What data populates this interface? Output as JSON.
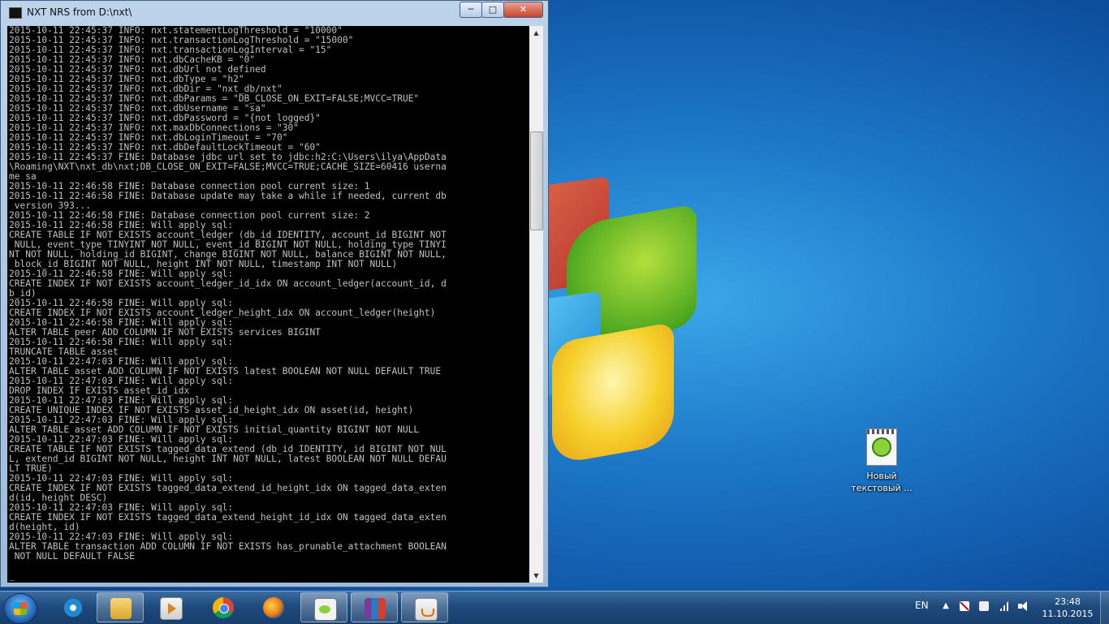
{
  "window": {
    "title": "NXT NRS from D:\\nxt\\",
    "controls": {
      "minimize": "─",
      "maximize": "□",
      "close": "✕"
    }
  },
  "console_lines": [
    "2015-10-11 22:45:37 INFO: nxt.statementLogThreshold = \"10000\"",
    "2015-10-11 22:45:37 INFO: nxt.transactionLogThreshold = \"15000\"",
    "2015-10-11 22:45:37 INFO: nxt.transactionLogInterval = \"15\"",
    "2015-10-11 22:45:37 INFO: nxt.dbCacheKB = \"0\"",
    "2015-10-11 22:45:37 INFO: nxt.dbUrl not defined",
    "2015-10-11 22:45:37 INFO: nxt.dbType = \"h2\"",
    "2015-10-11 22:45:37 INFO: nxt.dbDir = \"nxt_db/nxt\"",
    "2015-10-11 22:45:37 INFO: nxt.dbParams = \"DB_CLOSE_ON_EXIT=FALSE;MVCC=TRUE\"",
    "2015-10-11 22:45:37 INFO: nxt.dbUsername = \"sa\"",
    "2015-10-11 22:45:37 INFO: nxt.dbPassword = \"{not logged}\"",
    "2015-10-11 22:45:37 INFO: nxt.maxDbConnections = \"30\"",
    "2015-10-11 22:45:37 INFO: nxt.dbLoginTimeout = \"70\"",
    "2015-10-11 22:45:37 INFO: nxt.dbDefaultLockTimeout = \"60\"",
    "2015-10-11 22:45:37 FINE: Database jdbc url set to jdbc:h2:C:\\Users\\ilya\\AppData",
    "\\Roaming\\NXT\\nxt_db\\nxt;DB_CLOSE_ON_EXIT=FALSE;MVCC=TRUE;CACHE_SIZE=60416 userna",
    "me sa",
    "2015-10-11 22:46:58 FINE: Database connection pool current size: 1",
    "2015-10-11 22:46:58 FINE: Database update may take a while if needed, current db",
    " version 393...",
    "2015-10-11 22:46:58 FINE: Database connection pool current size: 2",
    "2015-10-11 22:46:58 FINE: Will apply sql:",
    "CREATE TABLE IF NOT EXISTS account_ledger (db_id IDENTITY, account_id BIGINT NOT",
    " NULL, event_type TINYINT NOT NULL, event_id BIGINT NOT NULL, holding_type TINYI",
    "NT NOT NULL, holding_id BIGINT, change BIGINT NOT NULL, balance BIGINT NOT NULL,",
    " block_id BIGINT NOT NULL, height INT NOT NULL, timestamp INT NOT NULL)",
    "2015-10-11 22:46:58 FINE: Will apply sql:",
    "CREATE INDEX IF NOT EXISTS account_ledger_id_idx ON account_ledger(account_id, d",
    "b_id)",
    "2015-10-11 22:46:58 FINE: Will apply sql:",
    "CREATE INDEX IF NOT EXISTS account_ledger_height_idx ON account_ledger(height)",
    "2015-10-11 22:46:58 FINE: Will apply sql:",
    "ALTER TABLE peer ADD COLUMN IF NOT EXISTS services BIGINT",
    "2015-10-11 22:46:58 FINE: Will apply sql:",
    "TRUNCATE TABLE asset",
    "2015-10-11 22:47:03 FINE: Will apply sql:",
    "ALTER TABLE asset ADD COLUMN IF NOT EXISTS latest BOOLEAN NOT NULL DEFAULT TRUE",
    "2015-10-11 22:47:03 FINE: Will apply sql:",
    "DROP INDEX IF EXISTS asset_id_idx",
    "2015-10-11 22:47:03 FINE: Will apply sql:",
    "CREATE UNIQUE INDEX IF NOT EXISTS asset_id_height_idx ON asset(id, height)",
    "2015-10-11 22:47:03 FINE: Will apply sql:",
    "ALTER TABLE asset ADD COLUMN IF NOT EXISTS initial_quantity BIGINT NOT NULL",
    "2015-10-11 22:47:03 FINE: Will apply sql:",
    "CREATE TABLE IF NOT EXISTS tagged_data_extend (db_id IDENTITY, id BIGINT NOT NUL",
    "L, extend_id BIGINT NOT NULL, height INT NOT NULL, latest BOOLEAN NOT NULL DEFAU",
    "LT TRUE)",
    "2015-10-11 22:47:03 FINE: Will apply sql:",
    "CREATE INDEX IF NOT EXISTS tagged_data_extend_id_height_idx ON tagged_data_exten",
    "d(id, height DESC)",
    "2015-10-11 22:47:03 FINE: Will apply sql:",
    "CREATE INDEX IF NOT EXISTS tagged_data_extend_height_id_idx ON tagged_data_exten",
    "d(height, id)",
    "2015-10-11 22:47:03 FINE: Will apply sql:",
    "ALTER TABLE transaction ADD COLUMN IF NOT EXISTS has_prunable_attachment BOOLEAN",
    " NOT NULL DEFAULT FALSE",
    "",
    "_"
  ],
  "scrollbar": {
    "up": "▲",
    "down": "▼"
  },
  "desktop": {
    "icons": [
      {
        "name": "notepad-text-file",
        "label_line1": "Новый",
        "label_line2": "текстовый ..."
      }
    ]
  },
  "taskbar": {
    "language": "EN",
    "tray_arrow": "▲",
    "clock_time": "23:48",
    "clock_date": "11.10.2015",
    "apps": [
      {
        "name": "internet-explorer",
        "icon": "ie-icon",
        "active": false
      },
      {
        "name": "windows-explorer",
        "icon": "folder-icon",
        "active": true
      },
      {
        "name": "media-player",
        "icon": "media-player-icon",
        "active": false
      },
      {
        "name": "chrome",
        "icon": "chrome-icon",
        "active": false
      },
      {
        "name": "firefox",
        "icon": "firefox-icon",
        "active": false
      },
      {
        "name": "notepad-plus-plus",
        "icon": "notepad-plus-plus-icon",
        "active": true
      },
      {
        "name": "winrar",
        "icon": "winrar-icon",
        "active": true
      },
      {
        "name": "java-console",
        "icon": "java-icon",
        "active": true
      }
    ]
  }
}
